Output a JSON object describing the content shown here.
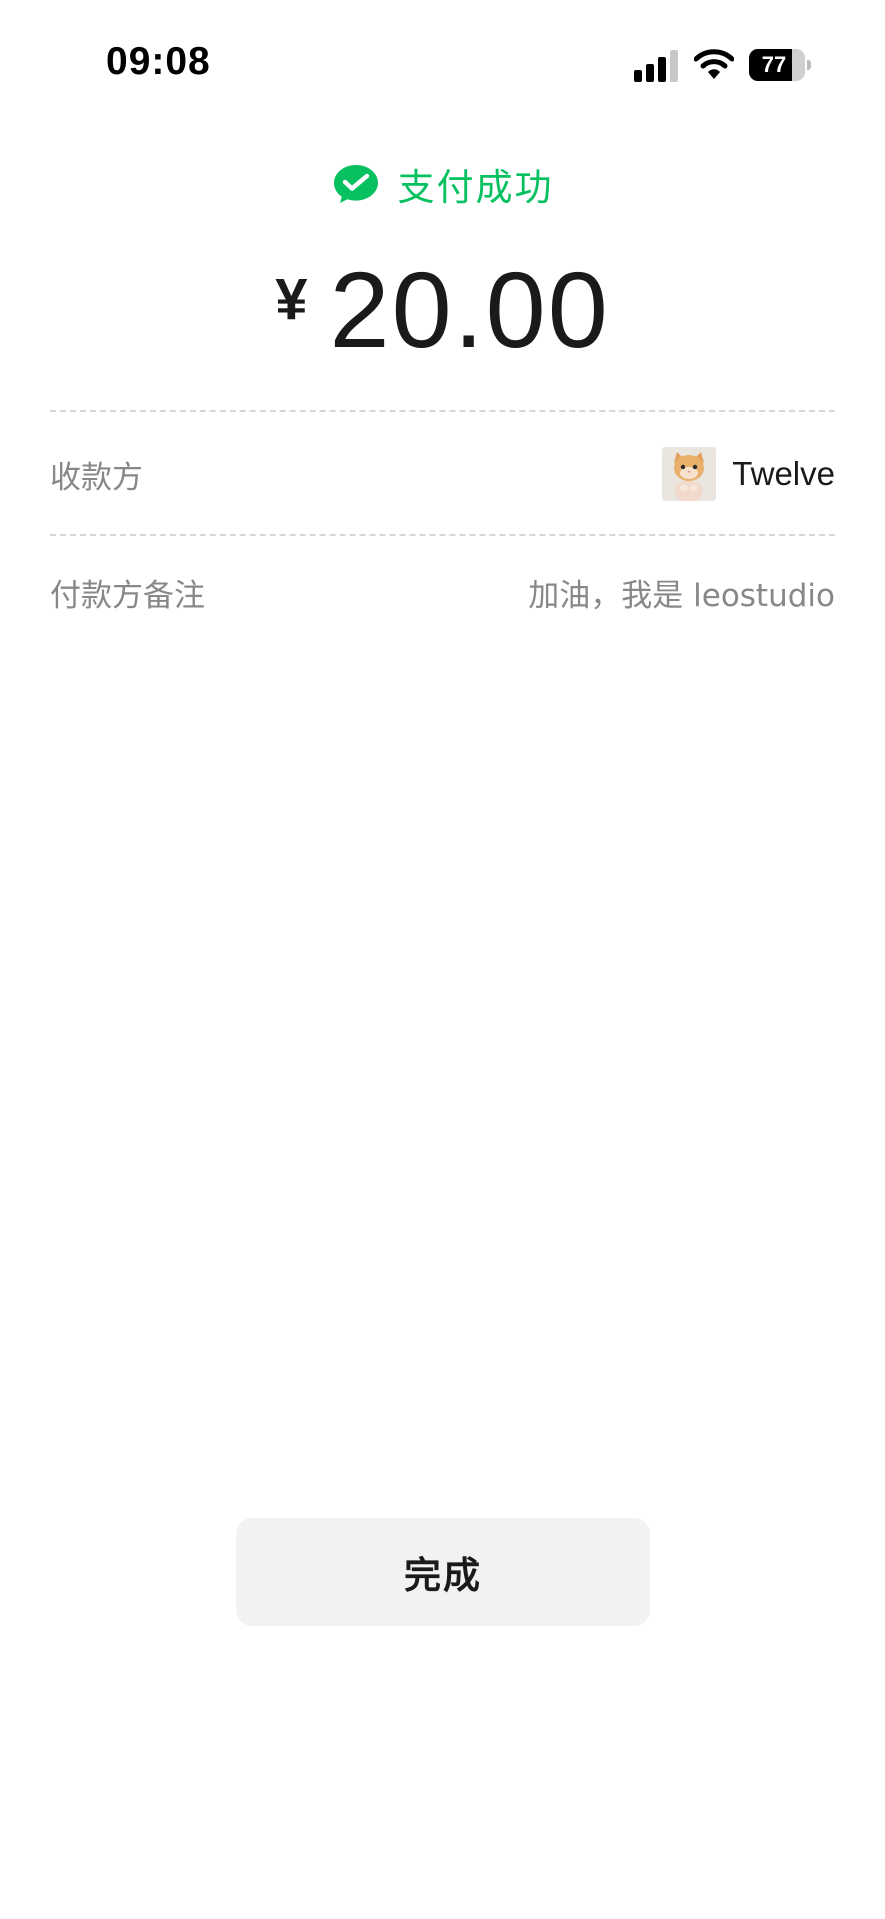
{
  "status_bar": {
    "time": "09:08",
    "battery_level": "77",
    "battery_fraction": 0.77
  },
  "header": {
    "success_text": "支付成功",
    "currency_symbol": "¥",
    "amount": "20.00",
    "accent_color": "#07c160"
  },
  "details": {
    "payee_label": "收款方",
    "payee_name": "Twelve",
    "payee_avatar": "cat-avatar",
    "note_label": "付款方备注",
    "note_value": "加油，我是 leostudio"
  },
  "actions": {
    "done_label": "完成"
  }
}
